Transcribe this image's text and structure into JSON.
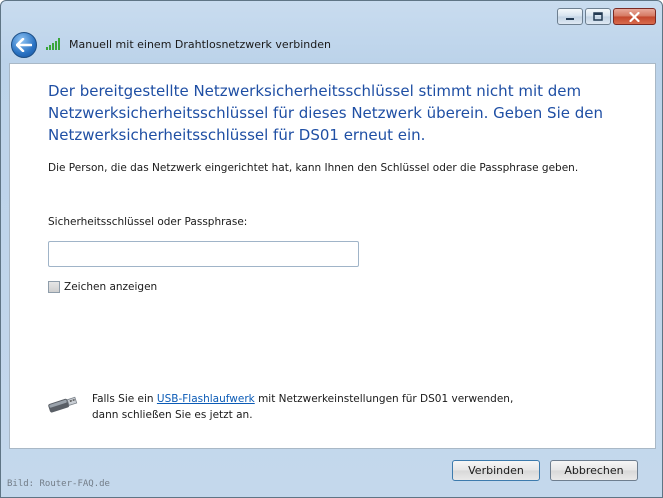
{
  "titlebar": {
    "title": "Manuell mit einem Drahtlosnetzwerk verbinden"
  },
  "content": {
    "heading": "Der bereitgestellte Netzwerksicherheitsschlüssel stimmt nicht mit dem Netzwerksicherheitsschlüssel für dieses Netzwerk überein. Geben Sie den Netzwerksicherheitsschlüssel für DS01 erneut ein.",
    "description": "Die Person, die das Netzwerk eingerichtet hat, kann Ihnen den Schlüssel oder die Passphrase geben.",
    "key_label": "Sicherheitsschlüssel oder Passphrase:",
    "key_value": "",
    "show_chars_label": "Zeichen anzeigen",
    "show_chars_checked": false,
    "usb": {
      "text_before": "Falls Sie ein ",
      "link": "USB-Flashlaufwerk",
      "text_after": " mit Netzwerkeinstellungen für DS01 verwenden,",
      "line2": "dann schließen Sie es jetzt an."
    }
  },
  "footer": {
    "connect_label": "Verbinden",
    "cancel_label": "Abbrechen",
    "watermark": "Bild: Router-FAQ.de"
  },
  "icons": {
    "back": "back-arrow-icon",
    "signal": "wireless-signal-icon",
    "usb": "usb-drive-icon"
  },
  "colors": {
    "heading": "#1f4fa4",
    "link": "#0b5bb6",
    "signal_bars": "#3aa53a"
  }
}
